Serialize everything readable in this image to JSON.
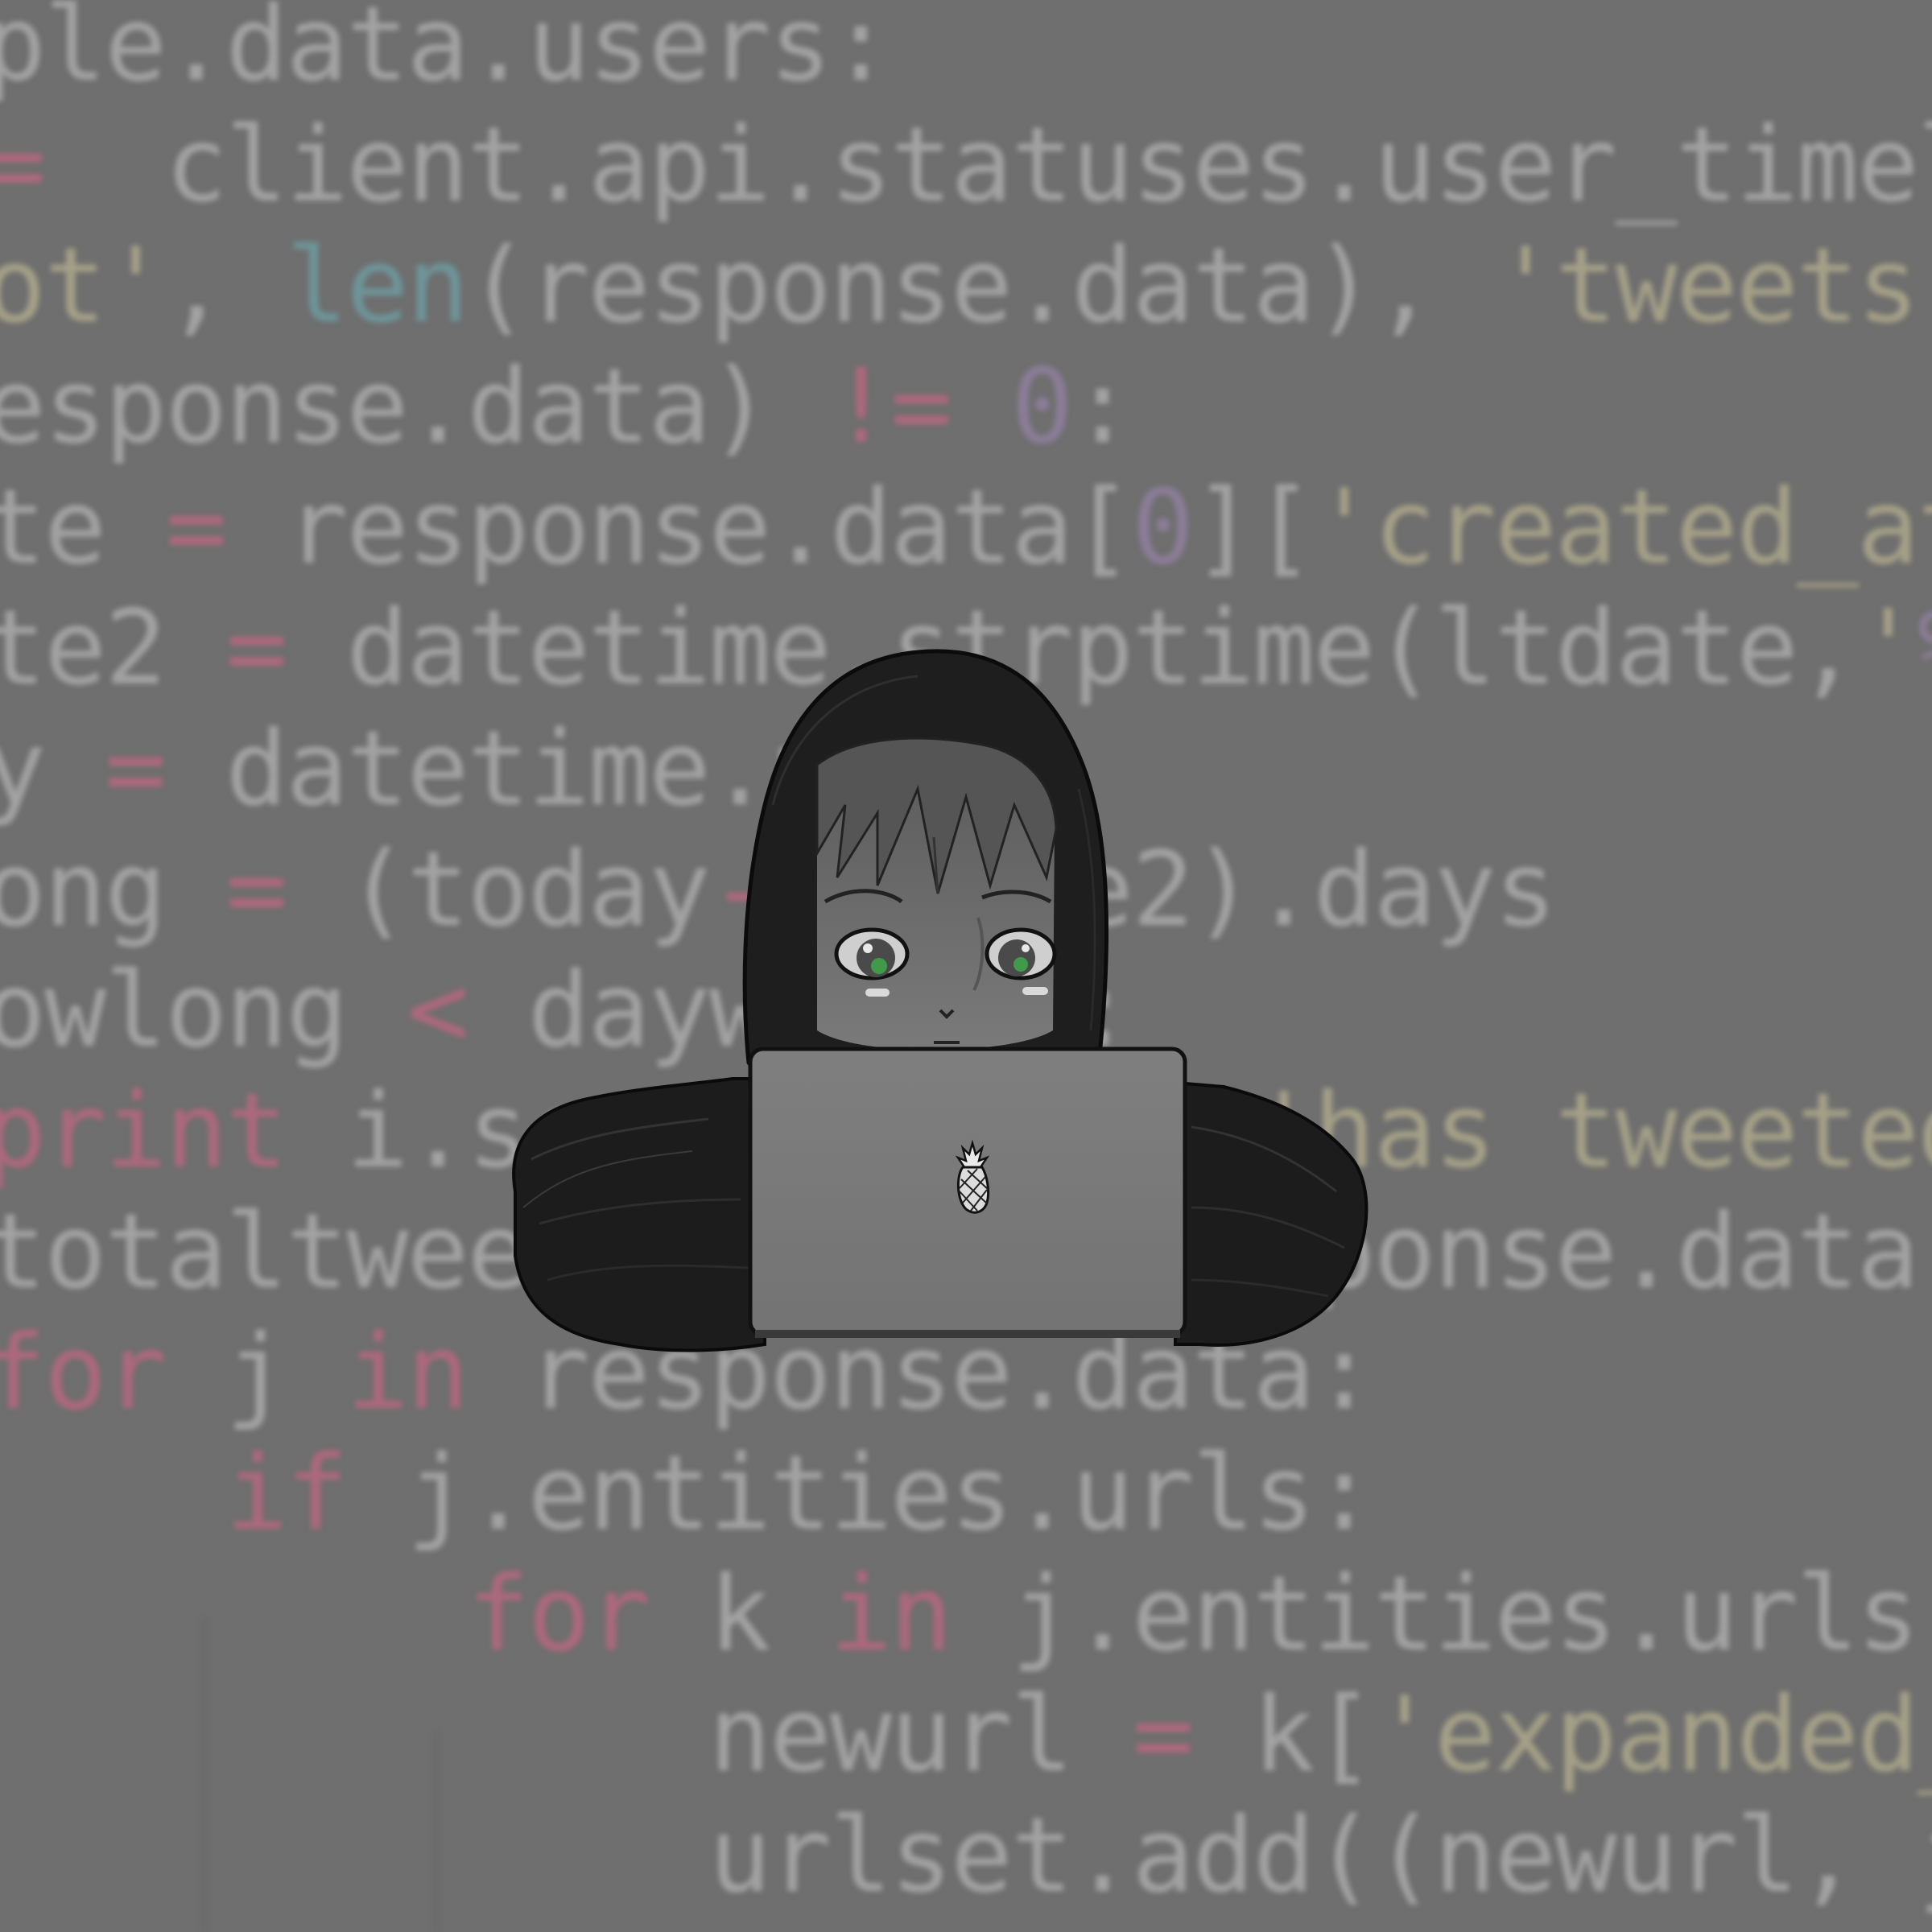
{
  "code_lines": [
    {
      "segments": [
        {
          "t": "ple.data.users:",
          "c": "pl"
        }
      ]
    },
    {
      "segments": [
        {
          "t": "= ",
          "c": "kw"
        },
        {
          "t": " client.api.statuses.user_timelin",
          "c": "pl"
        }
      ]
    },
    {
      "segments": [
        {
          "t": "ot'",
          "c": "str"
        },
        {
          "t": ", ",
          "c": "pl"
        },
        {
          "t": "len",
          "c": "fn"
        },
        {
          "t": "(response.data), ",
          "c": "pl"
        },
        {
          "t": "'tweets fr",
          "c": "str"
        }
      ]
    },
    {
      "segments": [
        {
          "t": "esponse.data) ",
          "c": "pl"
        },
        {
          "t": "!=",
          "c": "kw"
        },
        {
          "t": " ",
          "c": "pl"
        },
        {
          "t": "0",
          "c": "num"
        },
        {
          "t": ":",
          "c": "pl"
        }
      ]
    },
    {
      "segments": [
        {
          "t": "te ",
          "c": "pl"
        },
        {
          "t": "=",
          "c": "kw"
        },
        {
          "t": " response.data[",
          "c": "pl"
        },
        {
          "t": "0",
          "c": "num"
        },
        {
          "t": "][",
          "c": "pl"
        },
        {
          "t": "'created_at'",
          "c": "str"
        },
        {
          "t": "]",
          "c": "pl"
        }
      ]
    },
    {
      "segments": [
        {
          "t": "te2 ",
          "c": "pl"
        },
        {
          "t": "=",
          "c": "kw"
        },
        {
          "t": " datetime.strptime(ltdate,",
          "c": "pl"
        },
        {
          "t": "'",
          "c": "str"
        },
        {
          "t": "%a",
          "c": "num"
        }
      ]
    },
    {
      "segments": [
        {
          "t": "y ",
          "c": "pl"
        },
        {
          "t": "=",
          "c": "kw"
        },
        {
          "t": " datetime.now",
          "c": "pl"
        }
      ]
    },
    {
      "segments": [
        {
          "t": "ong ",
          "c": "pl"
        },
        {
          "t": "=",
          "c": "kw"
        },
        {
          "t": " (today",
          "c": "pl"
        },
        {
          "t": "-",
          "c": "kw"
        },
        {
          "t": "ltdate2).days",
          "c": "pl"
        }
      ]
    },
    {
      "segments": [
        {
          "t": "owlong ",
          "c": "pl"
        },
        {
          "t": "<",
          "c": "kw"
        },
        {
          "t": " daywindow:",
          "c": "pl"
        }
      ]
    },
    {
      "segments": [
        {
          "t": "print",
          "c": "kw"
        },
        {
          "t": " i.screen_name, ",
          "c": "pl"
        },
        {
          "t": "'has tweeted i",
          "c": "str"
        }
      ]
    },
    {
      "segments": [
        {
          "t": "totaltweets ",
          "c": "pl"
        },
        {
          "t": "+=",
          "c": "kw"
        },
        {
          "t": " len(response.data)",
          "c": "pl"
        }
      ]
    },
    {
      "segments": [
        {
          "t": "for",
          "c": "kw"
        },
        {
          "t": " j ",
          "c": "pl"
        },
        {
          "t": "in",
          "c": "kw"
        },
        {
          "t": " response.data:",
          "c": "pl"
        }
      ]
    },
    {
      "segments": [
        {
          "t": "    ",
          "c": "pl"
        },
        {
          "t": "if",
          "c": "kw"
        },
        {
          "t": " j.entities.urls:",
          "c": "pl"
        }
      ]
    },
    {
      "segments": [
        {
          "t": "        ",
          "c": "pl"
        },
        {
          "t": "for",
          "c": "kw"
        },
        {
          "t": " k ",
          "c": "pl"
        },
        {
          "t": "in",
          "c": "kw"
        },
        {
          "t": " j.entities.urls:",
          "c": "pl"
        }
      ]
    },
    {
      "segments": [
        {
          "t": "            newurl ",
          "c": "pl"
        },
        {
          "t": "=",
          "c": "kw"
        },
        {
          "t": " k[",
          "c": "pl"
        },
        {
          "t": "'expanded_u",
          "c": "str"
        }
      ]
    },
    {
      "segments": [
        {
          "t": "            urlset.add((newurl, j.",
          "c": "pl"
        }
      ]
    }
  ],
  "colors": {
    "background": "#6f6f6f",
    "plain": "#a8a8a8",
    "keyword": "#b5687f",
    "builtin": "#6e9a9e",
    "string": "#aba68a",
    "number": "#8f7f9d",
    "hoodie": "#1e1e1e",
    "laptop": "#7a7a7a",
    "eyes": "#3f9a4a"
  },
  "illustration": {
    "subject": "hooded-figure-with-laptop",
    "laptop_logo": "pineapple-icon"
  }
}
